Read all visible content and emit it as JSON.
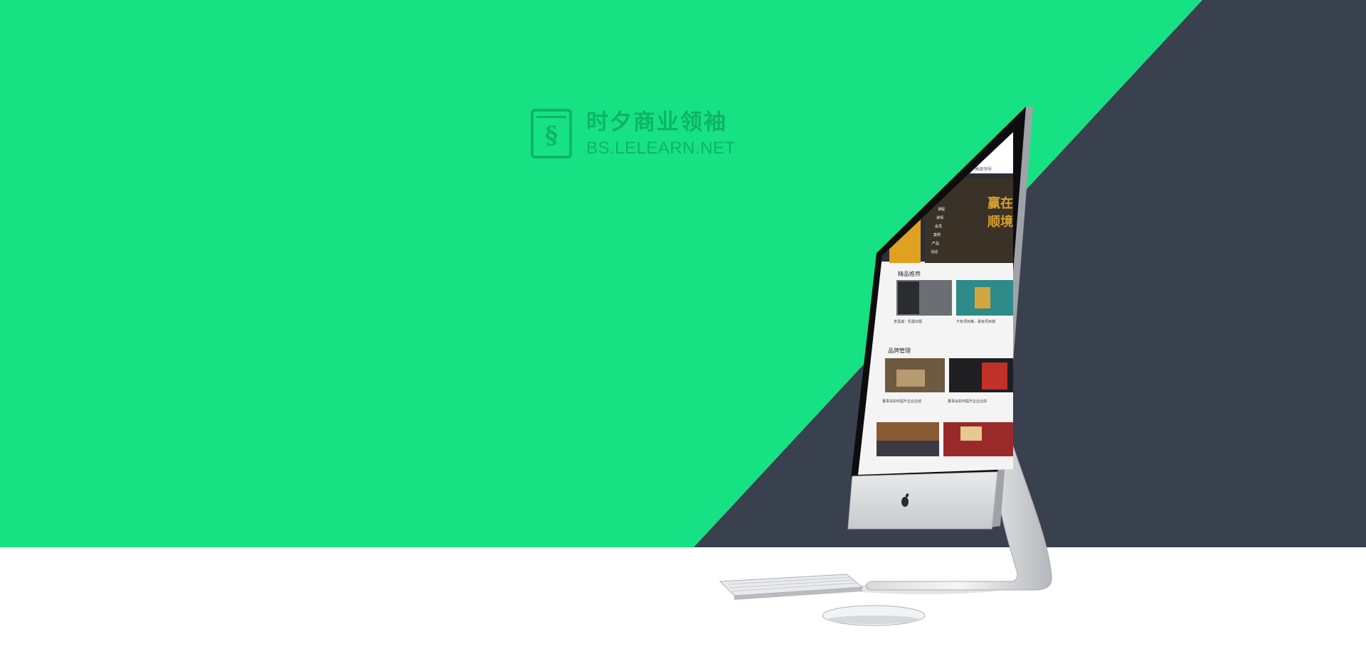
{
  "brand": {
    "name": "时夕商业领袖",
    "url": "BS.LELEARN.NET",
    "icon": "section-sign-icon",
    "icon_glyph": "§"
  },
  "screen": {
    "topbar_label": "高级领导",
    "banner_text_1": "赢在",
    "banner_text_2": "顺境",
    "section_1_title": "精品推荐",
    "section_2_title": "品牌管理",
    "card_texts": [
      "李嘉诚：机遇出题",
      "不有项目策，最有项目做",
      "董事会如何提升企业业绩",
      "董事会如何提升企业业绩"
    ],
    "side_menu": [
      "课程",
      "讲师",
      "会员",
      "案例",
      "产品",
      "活动"
    ]
  },
  "colors": {
    "green": "#16e283",
    "dark": "#38414d",
    "brand_green": "#0fb368",
    "white": "#ffffff"
  }
}
